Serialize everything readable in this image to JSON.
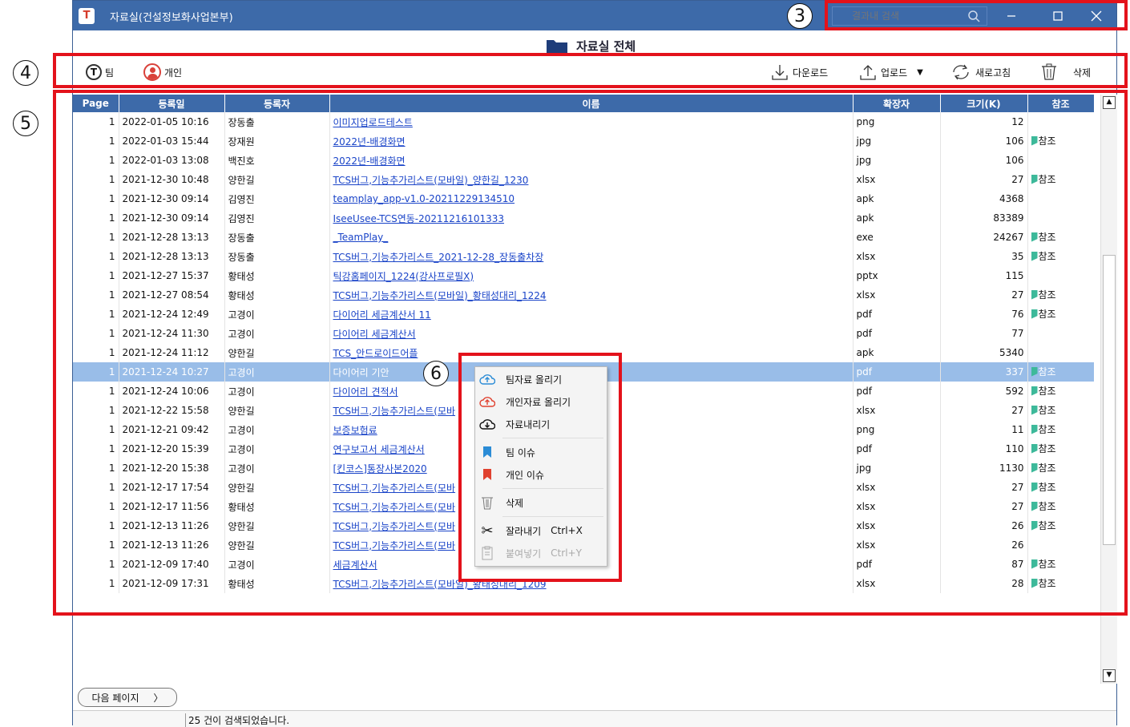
{
  "window": {
    "title": "자료실(건설정보화사업본부)",
    "app_icon": "T",
    "subtitle": "자료실 전체",
    "search_placeholder": "결과내 검색"
  },
  "toolbar": {
    "team_icon_letter": "T",
    "team_label": "팀",
    "personal_label": "개인",
    "download_label": "다운로드",
    "upload_label": "업로드",
    "refresh_label": "새로고침",
    "delete_label": "삭제"
  },
  "columns": [
    "Page",
    "등록일",
    "등록자",
    "이름",
    "확장자",
    "크기(K)",
    "참조"
  ],
  "rows": [
    {
      "page": "1",
      "date": "2022-01-05 10:16",
      "user": "장동출",
      "name": "이미지업로드테스트",
      "ext": "png",
      "size": "12",
      "ref": ""
    },
    {
      "page": "1",
      "date": "2022-01-03 15:44",
      "user": "장재원",
      "name": "2022년-배경화면",
      "ext": "jpg",
      "size": "106",
      "ref": "참조"
    },
    {
      "page": "1",
      "date": "2022-01-03 13:08",
      "user": "백진호",
      "name": "2022년-배경화면",
      "ext": "jpg",
      "size": "106",
      "ref": ""
    },
    {
      "page": "1",
      "date": "2021-12-30 10:48",
      "user": "양한길",
      "name": "TCS버그,기능추가리스트(모바일)_양한길_1230",
      "ext": "xlsx",
      "size": "27",
      "ref": "참조"
    },
    {
      "page": "1",
      "date": "2021-12-30 09:14",
      "user": "김영진",
      "name": "teamplay_app-v1.0-20211229134510",
      "ext": "apk",
      "size": "4368",
      "ref": ""
    },
    {
      "page": "1",
      "date": "2021-12-30 09:14",
      "user": "김영진",
      "name": "IseeUsee-TCS연동-20211216101333",
      "ext": "apk",
      "size": "83389",
      "ref": ""
    },
    {
      "page": "1",
      "date": "2021-12-28 13:13",
      "user": "장동출",
      "name": "_TeamPlay_",
      "ext": "exe",
      "size": "24267",
      "ref": "참조"
    },
    {
      "page": "1",
      "date": "2021-12-28 13:13",
      "user": "장동출",
      "name": "TCS버그,기능추가리스트_2021-12-28_장동출차장",
      "ext": "xlsx",
      "size": "35",
      "ref": "참조"
    },
    {
      "page": "1",
      "date": "2021-12-27 15:37",
      "user": "황태성",
      "name": "틱강홈페이지_1224(강사프로필X)",
      "ext": "pptx",
      "size": "115",
      "ref": ""
    },
    {
      "page": "1",
      "date": "2021-12-27 08:54",
      "user": "황태성",
      "name": "TCS버그,기능추가리스트(모바일)_황태성대리_1224",
      "ext": "xlsx",
      "size": "27",
      "ref": "참조"
    },
    {
      "page": "1",
      "date": "2021-12-24 12:49",
      "user": "고경이",
      "name": "다이어리 세금계산서 11",
      "ext": "pdf",
      "size": "76",
      "ref": "참조"
    },
    {
      "page": "1",
      "date": "2021-12-24 11:30",
      "user": "고경이",
      "name": "다이어리 세금계산서",
      "ext": "pdf",
      "size": "77",
      "ref": ""
    },
    {
      "page": "1",
      "date": "2021-12-24 11:12",
      "user": "양한길",
      "name": "TCS_안드로이드어플",
      "ext": "apk",
      "size": "5340",
      "ref": ""
    },
    {
      "page": "1",
      "date": "2021-12-24 10:27",
      "user": "고경이",
      "name": "다이어리 기안",
      "ext": "pdf",
      "size": "337",
      "ref": "참조",
      "selected": true
    },
    {
      "page": "1",
      "date": "2021-12-24 10:06",
      "user": "고경이",
      "name": "다이어리 견적서",
      "ext": "pdf",
      "size": "592",
      "ref": "참조"
    },
    {
      "page": "1",
      "date": "2021-12-22 15:58",
      "user": "양한길",
      "name": "TCS버그,기능추가리스트(모바",
      "ext": "xlsx",
      "size": "27",
      "ref": "참조"
    },
    {
      "page": "1",
      "date": "2021-12-21 09:42",
      "user": "고경이",
      "name": "보증보험료",
      "ext": "png",
      "size": "11",
      "ref": "참조"
    },
    {
      "page": "1",
      "date": "2021-12-20 15:39",
      "user": "고경이",
      "name": "연구보고서 세금계산서",
      "ext": "pdf",
      "size": "110",
      "ref": "참조"
    },
    {
      "page": "1",
      "date": "2021-12-20 15:38",
      "user": "고경이",
      "name": "[킨코스]통장사본2020",
      "ext": "jpg",
      "size": "1130",
      "ref": "참조"
    },
    {
      "page": "1",
      "date": "2021-12-17 17:54",
      "user": "양한길",
      "name": "TCS버그,기능추가리스트(모바",
      "ext": "xlsx",
      "size": "27",
      "ref": "참조"
    },
    {
      "page": "1",
      "date": "2021-12-17 11:56",
      "user": "황태성",
      "name": "TCS버그,기능추가리스트(모바",
      "ext": "xlsx",
      "size": "27",
      "ref": "참조"
    },
    {
      "page": "1",
      "date": "2021-12-13 11:26",
      "user": "양한길",
      "name": "TCS버그,기능추가리스트(모바",
      "ext": "xlsx",
      "size": "26",
      "ref": "참조"
    },
    {
      "page": "1",
      "date": "2021-12-13 11:26",
      "user": "양한길",
      "name": "TCS버그,기능추가리스트(모바",
      "ext": "xlsx",
      "size": "26",
      "ref": ""
    },
    {
      "page": "1",
      "date": "2021-12-09 17:40",
      "user": "고경이",
      "name": "세금계산서",
      "ext": "pdf",
      "size": "87",
      "ref": "참조"
    },
    {
      "page": "1",
      "date": "2021-12-09 17:31",
      "user": "황태성",
      "name": "TCS버그,기능추가리스트(모바일)_황태성대리_1209",
      "ext": "xlsx",
      "size": "28",
      "ref": "참조"
    }
  ],
  "context_menu": {
    "team_upload": "팀자료 올리기",
    "personal_upload": "개인자료 올리기",
    "download": "자료내리기",
    "team_issue": "팀 이슈",
    "personal_issue": "개인 이슈",
    "delete": "삭제",
    "cut": "잘라내기",
    "cut_shortcut": "Ctrl+X",
    "paste": "붙여넣기",
    "paste_shortcut": "Ctrl+Y"
  },
  "next_page_label": "다음 페이지",
  "status_text": "25 건이 검색되었습니다.",
  "markers": {
    "m3": "3",
    "m4": "4",
    "m5": "5",
    "m6": "6"
  },
  "colors": {
    "header": "#3d6aa9",
    "highlight": "#e3121b",
    "selected_row": "#99bde8",
    "link": "#1a44c8"
  }
}
